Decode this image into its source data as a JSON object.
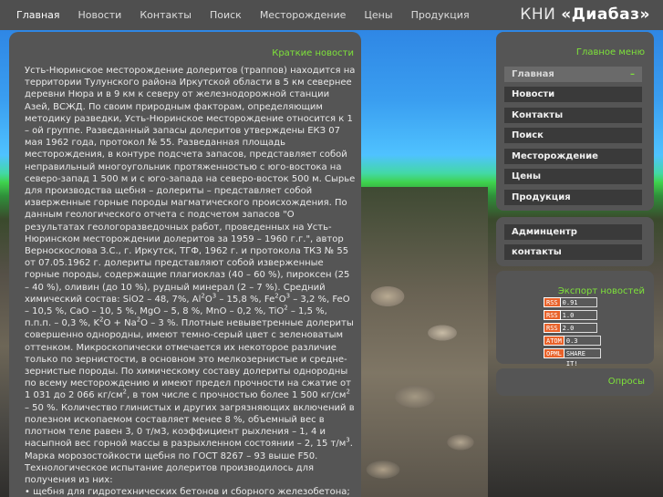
{
  "nav": {
    "items": [
      "Главная",
      "Новости",
      "Контакты",
      "Поиск",
      "Месторождение",
      "Цены",
      "Продукция"
    ],
    "active_index": 0
  },
  "logo": {
    "prefix": "КНИ ",
    "name": "«Диабаз»"
  },
  "news": {
    "heading": "Краткие новости",
    "p1": "Усть-Нюринское месторождение долеритов (траппов) находится на территории Тулунского района Иркутской области в 5 км севернее деревни Нюра и в 9 км к северу от железнодорожной станции Азей, ВСЖД. По своим природным факторам, определяющим методику разведки, Усть-Нюринское месторождение относится к 1 – ой группе. Разведанный запасы долеритов утверждены ЕКЗ 07 мая 1962 года, протокол № 55. Разведанная площадь месторождения, в контуре подсчета запасов, представляет собой неправильный многоугольник протяженностью с юго-востока на северо-запад 1 500 м и с юго-запада на северо-восток 500 м. Сырье для производства щебня – долериты – представляет собой изверженные горные породы магматического происхождения. По данным геологического отчета с подсчетом запасов \"О результатах геологоразведочных работ, проведенных на Усть-Нюринском месторождении долеритов за 1959 – 1960 г.г.\", автор Верноскослова З.С., г. Иркутск, ТГФ, 1962 г. и протокола ТКЗ № 55 от 07.05.1962 г. долериты представляют собой изверженные горные породы, содержащие плагиоклаз (40 – 60 %), пироксен (25 – 40 %), оливин (до 10 %), рудный минерал (2 – 7 %). Средний химический состав: SiO2 – 48, 7%, Al2O3 – 15,8 %, Fe2O3 – 3,2 %, FeO – 10,5 %, CaO – 10, 5 %, MgO – 5, 8 %, MnO – 0,2 %, TiO2 – 1,5 %, п.п.п. – 0,3 %, K2O + Na2O – 3 %. Плотные невыветренные долериты совершенно однородны, имеют темно-серый цвет с зеленоватым оттенком. Микроскопически отмечается их некоторое различие только по зернистости, в основном это мелкозернистые и средне-зернистые породы. По химическому составу долериты однородны по всему месторождению и имеют предел прочности на сжатие от 1 031 до 2 066 кг/см2, в том числе с прочностью более 1 500 кг/см2 – 50 %. Количество глинистых и других загрязняющих включений в полезном ископаемом составляет менее 8 %, объемный вес в плотном теле равен 3, 0 т/м3, коэффициент рыхления – 1, 4 и насыпной вес горной массы в разрыхленном состоянии – 2, 15 т/м3.",
    "p2": "Марка морозостойкости щебня по ГОСТ 8267 – 93 выше F50. Технологическое испытание долеритов производилось для получения из них:",
    "p3": "• щебня для гидротехнических бетонов и сборного железобетона;"
  },
  "menu": {
    "main_heading": "Главное меню",
    "items": [
      "Главная",
      "Новости",
      "Контакты",
      "Поиск",
      "Месторождение",
      "Цены",
      "Продукция"
    ],
    "active_marker": "–",
    "admin_items": [
      "Админцентр",
      "контакты"
    ],
    "export_heading": "Экспорт новостей",
    "feeds": [
      {
        "tag": "RSS",
        "ver": "0.91"
      },
      {
        "tag": "RSS",
        "ver": "1.0"
      },
      {
        "tag": "RSS",
        "ver": "2.0"
      },
      {
        "tag": "ATOM",
        "ver": "0.3"
      },
      {
        "tag": "OPML",
        "ver": "SHARE IT!"
      }
    ],
    "polls_heading": "Опросы"
  },
  "colors": {
    "accent_green": "#7ee23a",
    "panel": "#555555",
    "menu_item": "#3a3a3a",
    "rss_orange": "#e8622a"
  }
}
